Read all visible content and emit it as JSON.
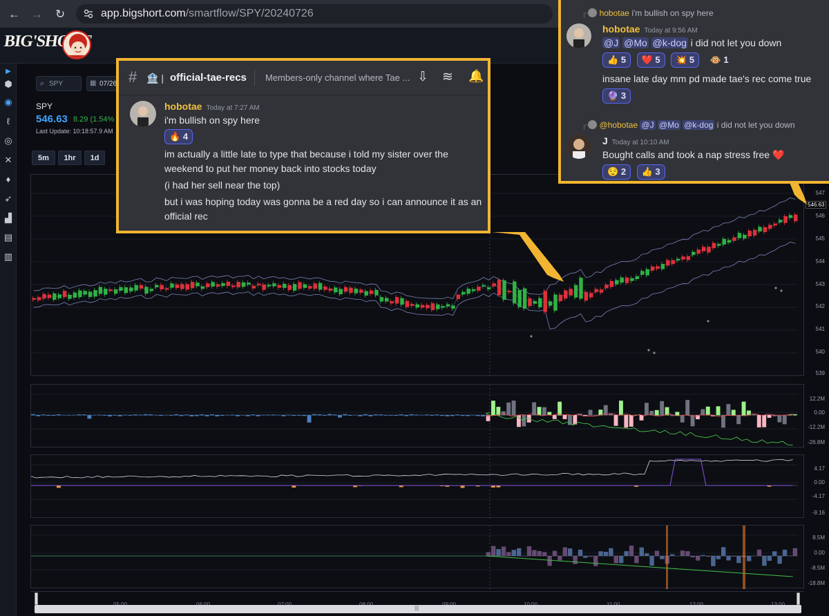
{
  "browser": {
    "url_host": "app.bigshort.com",
    "url_path": "/smartflow/SPY/20240726"
  },
  "app": {
    "logo_text": "BIG'SHORT"
  },
  "ticker": {
    "search": "SPY",
    "date": "07/26",
    "symbol": "SPY",
    "price": "546.63",
    "change": "8.29 (1.54%",
    "last_update": "Last Update: 10:18:57.9 AM",
    "timeframes": [
      "5m",
      "1hr",
      "1d"
    ]
  },
  "chart": {
    "price_label": "546.63",
    "price_ticks": [
      "547",
      "546",
      "545",
      "544",
      "543",
      "542",
      "541",
      "540",
      "539"
    ],
    "pane2_ticks": [
      "12.2M",
      "0.00",
      "-12.2M",
      "-26.8M"
    ],
    "pane3_ticks": [
      "4.17",
      "0.00",
      "-4.17",
      "-9.16"
    ],
    "pane4_ticks": [
      "8.5M",
      "0.00",
      "-8.5M",
      "-18.8M"
    ],
    "time_ticks": [
      "05:00",
      "06:00",
      "07:00",
      "08:00",
      "09:00",
      "10:00",
      "11:00",
      "12:00",
      "13:00"
    ],
    "scroll_grip": "|||",
    "colors": {
      "up": "#2fb344",
      "down": "#e0303a",
      "band": "#a9b6ff",
      "accent": "#4aa3ff"
    }
  },
  "discord_left": {
    "channel_name": "official-tae-recs",
    "channel_prefix": "🏦 |",
    "topic": "Members-only channel where Tae ...",
    "message": {
      "author": "hobotae",
      "time": "Today at 7:27 AM",
      "lines": [
        "i'm bullish on spy here",
        "im actually a little late to type that because i told my sister over the weekend to put her money back into stocks today",
        "(i had her sell near the top)",
        "but i was hoping today was gonna be a red day so i can announce it as an official rec"
      ],
      "reaction": {
        "emoji": "🔥",
        "count": "4"
      }
    }
  },
  "discord_right": {
    "reply1": {
      "author": "hobotae",
      "text": "i'm bullish on spy here"
    },
    "msg1": {
      "author": "hobotae",
      "time": "Today at 9:56 AM",
      "mentions": [
        "@J",
        "@Mo",
        "@k-dog"
      ],
      "text": "i did not let you down",
      "reactions": [
        {
          "emoji": "👍",
          "count": "5"
        },
        {
          "emoji": "❤️",
          "count": "5"
        },
        {
          "emoji": "💥",
          "count": "5"
        },
        {
          "emoji": "🐵",
          "count": "1"
        }
      ],
      "text2": "insane late day mm pd made tae's rec come true",
      "reaction2": {
        "emoji": "🔮",
        "count": "3"
      }
    },
    "reply2": {
      "author": "@hobotae",
      "mentions": [
        "@J",
        "@Mo",
        "@k-dog"
      ],
      "text": "i did not let you down"
    },
    "msg2": {
      "author": "J",
      "time": "Today at 10:10 AM",
      "text": "Bought calls and took a nap stress free",
      "heart": "❤️",
      "reactions": [
        {
          "emoji": "😌",
          "count": "2"
        },
        {
          "emoji": "👍",
          "count": "3"
        }
      ]
    }
  }
}
